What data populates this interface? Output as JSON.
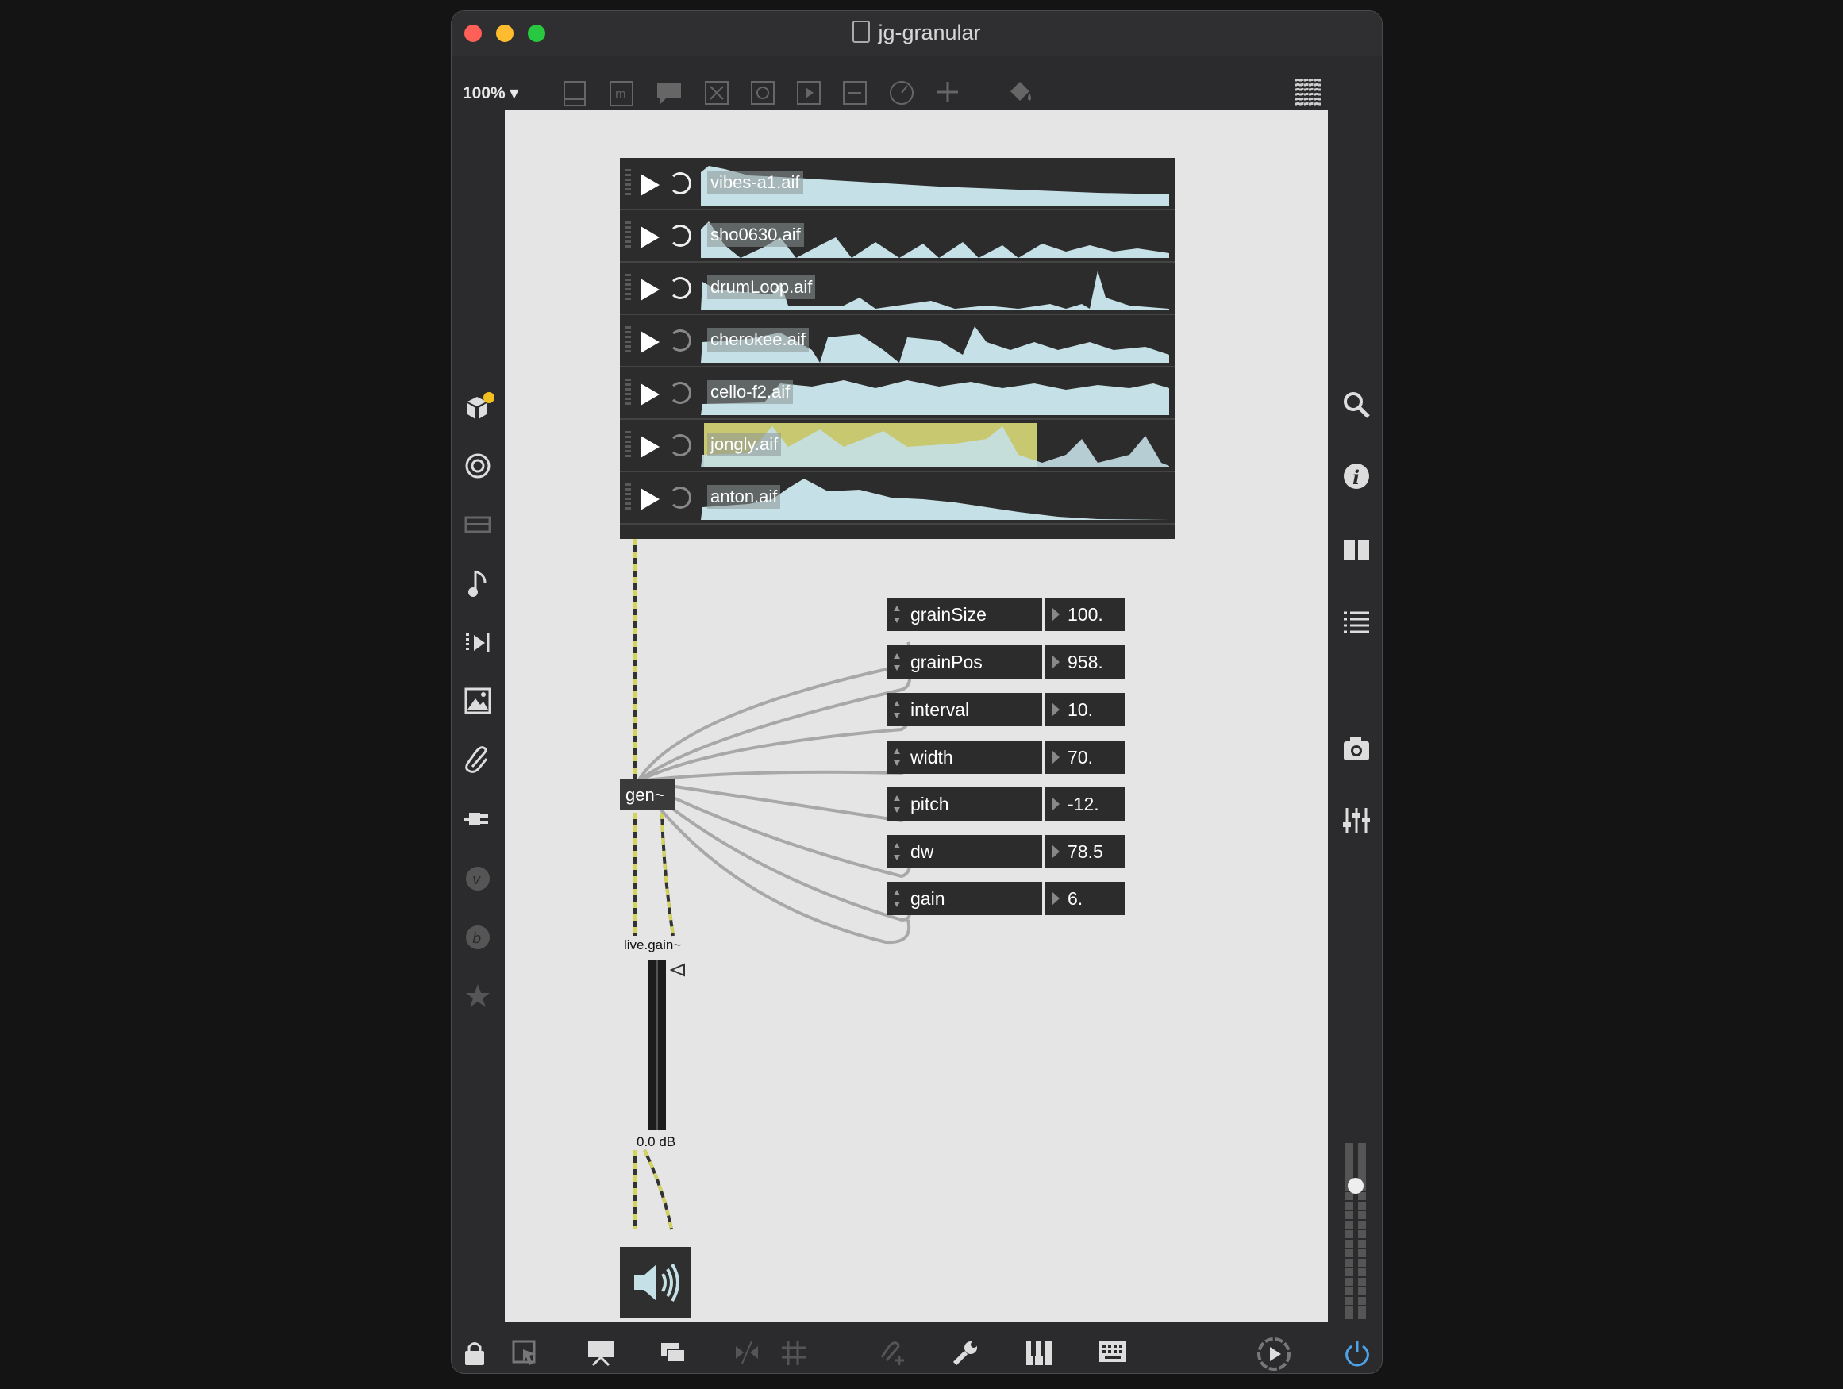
{
  "window": {
    "title": "jg-granular"
  },
  "toolbar": {
    "zoom": "100%"
  },
  "buffers": [
    {
      "name": "vibes-a1.aif",
      "loop": true
    },
    {
      "name": "sho0630.aif",
      "loop": true
    },
    {
      "name": "drumLoop.aif",
      "loop": true
    },
    {
      "name": "cherokee.aif",
      "loop": false
    },
    {
      "name": "cello-f2.aif",
      "loop": false
    },
    {
      "name": "jongly.aif",
      "loop": false,
      "selected": true
    },
    {
      "name": "anton.aif",
      "loop": false
    }
  ],
  "params": [
    {
      "name": "grainSize",
      "value": "100."
    },
    {
      "name": "grainPos",
      "value": "958."
    },
    {
      "name": "interval",
      "value": "10."
    },
    {
      "name": "width",
      "value": "70."
    },
    {
      "name": "pitch",
      "value": "-12."
    },
    {
      "name": "dw",
      "value": "78.5"
    },
    {
      "name": "gain",
      "value": "6."
    }
  ],
  "gen": {
    "label": "gen~"
  },
  "gain": {
    "label": "live.gain~",
    "value": "0.0 dB"
  },
  "colors": {
    "canvas": "#e5e5e5",
    "object": "#2c2c2c",
    "wave": "#c5e0e6",
    "highlight": "#c8c870",
    "signal_wire": "#d4d45a"
  }
}
